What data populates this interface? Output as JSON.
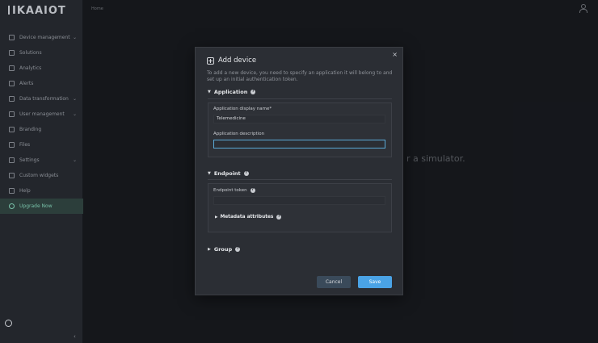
{
  "app": {
    "logo": "IKAAIOT",
    "breadcrumb": "Home"
  },
  "sidebar": {
    "items": [
      {
        "label": "Device management",
        "chevron": true
      },
      {
        "label": "Solutions",
        "chevron": false
      },
      {
        "label": "Analytics",
        "chevron": false
      },
      {
        "label": "Alerts",
        "chevron": false
      },
      {
        "label": "Data transformation",
        "chevron": true
      },
      {
        "label": "User management",
        "chevron": true
      },
      {
        "label": "Branding",
        "chevron": false
      },
      {
        "label": "Files",
        "chevron": false
      },
      {
        "label": "Settings",
        "chevron": true
      },
      {
        "label": "Custom widgets",
        "chevron": false
      },
      {
        "label": "Help",
        "chevron": false
      },
      {
        "label": "Upgrade Now",
        "chevron": false,
        "active": true
      }
    ],
    "chevron_glyph": "⌄",
    "collapse_glyph": "‹"
  },
  "background": {
    "hint_text": "r a simulator."
  },
  "dialog": {
    "title": "Add device",
    "close_glyph": "×",
    "description": "To add a new device, you need to specify an application it will belong to and set up an initial authentication token.",
    "application": {
      "heading": "Application",
      "display_name_label": "Application display name*",
      "display_name_value": "Telemedicine",
      "description_label": "Application description",
      "description_value": ""
    },
    "endpoint": {
      "heading": "Endpoint",
      "token_label": "Endpoint token",
      "token_value": "",
      "metadata_heading": "Metadata attributes"
    },
    "group": {
      "heading": "Group"
    },
    "help_glyph": "?",
    "expanded_glyph": "▼",
    "collapsed_glyph": "▶",
    "cancel_label": "Cancel",
    "save_label": "Save"
  },
  "colors": {
    "accent": "#4aa3e6",
    "active_nav": "#78c1a8"
  }
}
